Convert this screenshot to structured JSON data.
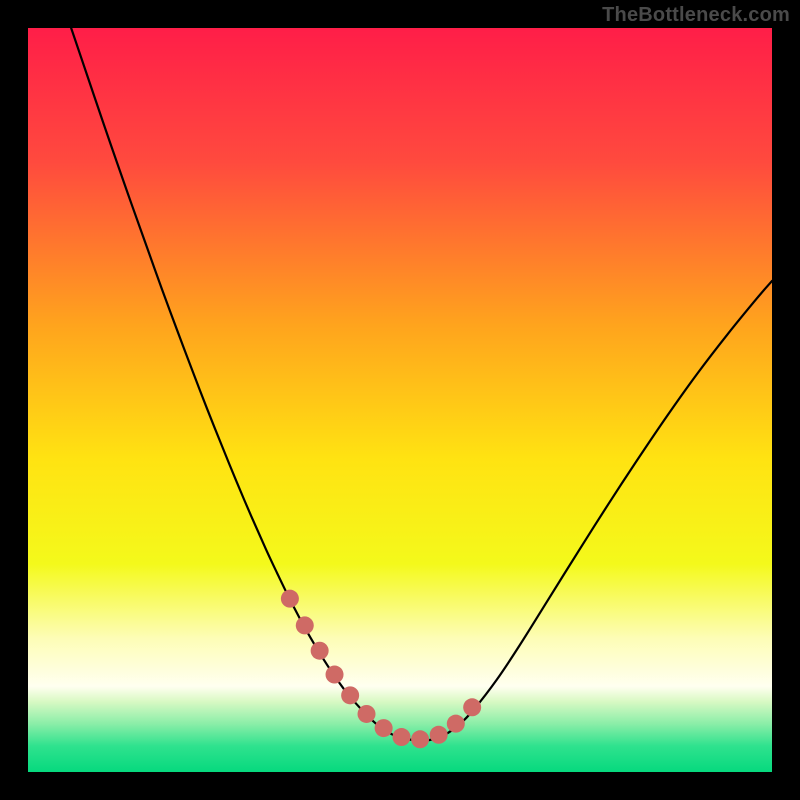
{
  "watermark": "TheBottleneck.com",
  "chart_data": {
    "type": "line",
    "title": "",
    "xlabel": "",
    "ylabel": "",
    "xlim": [
      0,
      1
    ],
    "ylim": [
      0,
      1
    ],
    "background_gradient": {
      "stops": [
        {
          "offset": 0.0,
          "color": "#ff1e48"
        },
        {
          "offset": 0.18,
          "color": "#ff4a3e"
        },
        {
          "offset": 0.4,
          "color": "#ffa41d"
        },
        {
          "offset": 0.58,
          "color": "#ffe312"
        },
        {
          "offset": 0.72,
          "color": "#f4f91b"
        },
        {
          "offset": 0.82,
          "color": "#fdfdb6"
        },
        {
          "offset": 0.885,
          "color": "#fffff0"
        },
        {
          "offset": 0.905,
          "color": "#d9f9c4"
        },
        {
          "offset": 0.935,
          "color": "#8beea8"
        },
        {
          "offset": 0.965,
          "color": "#2fe28e"
        },
        {
          "offset": 1.0,
          "color": "#06d97e"
        }
      ]
    },
    "series": [
      {
        "name": "bottleneck-curve",
        "color": "#000000",
        "stroke_width": 2.2,
        "x": [
          0.058,
          0.08,
          0.1,
          0.12,
          0.14,
          0.16,
          0.18,
          0.2,
          0.22,
          0.24,
          0.26,
          0.28,
          0.3,
          0.32,
          0.335,
          0.35,
          0.365,
          0.38,
          0.395,
          0.41,
          0.425,
          0.44,
          0.455,
          0.47,
          0.485,
          0.5,
          0.52,
          0.54,
          0.56,
          0.58,
          0.6,
          0.63,
          0.66,
          0.7,
          0.74,
          0.78,
          0.82,
          0.86,
          0.9,
          0.94,
          0.98,
          1.0
        ],
        "y": [
          1.0,
          0.935,
          0.876,
          0.818,
          0.761,
          0.705,
          0.649,
          0.595,
          0.542,
          0.49,
          0.44,
          0.391,
          0.344,
          0.299,
          0.267,
          0.236,
          0.207,
          0.18,
          0.155,
          0.132,
          0.111,
          0.093,
          0.077,
          0.063,
          0.053,
          0.046,
          0.043,
          0.043,
          0.05,
          0.064,
          0.085,
          0.124,
          0.169,
          0.233,
          0.297,
          0.36,
          0.421,
          0.48,
          0.536,
          0.588,
          0.637,
          0.66
        ]
      },
      {
        "name": "highlight-dots",
        "color": "#cf6a65",
        "marker_radius": 9,
        "x": [
          0.352,
          0.372,
          0.392,
          0.412,
          0.433,
          0.455,
          0.478,
          0.502,
          0.527,
          0.552,
          0.575,
          0.597
        ],
        "y": [
          0.233,
          0.197,
          0.163,
          0.131,
          0.103,
          0.078,
          0.059,
          0.047,
          0.044,
          0.05,
          0.065,
          0.087
        ]
      }
    ]
  }
}
